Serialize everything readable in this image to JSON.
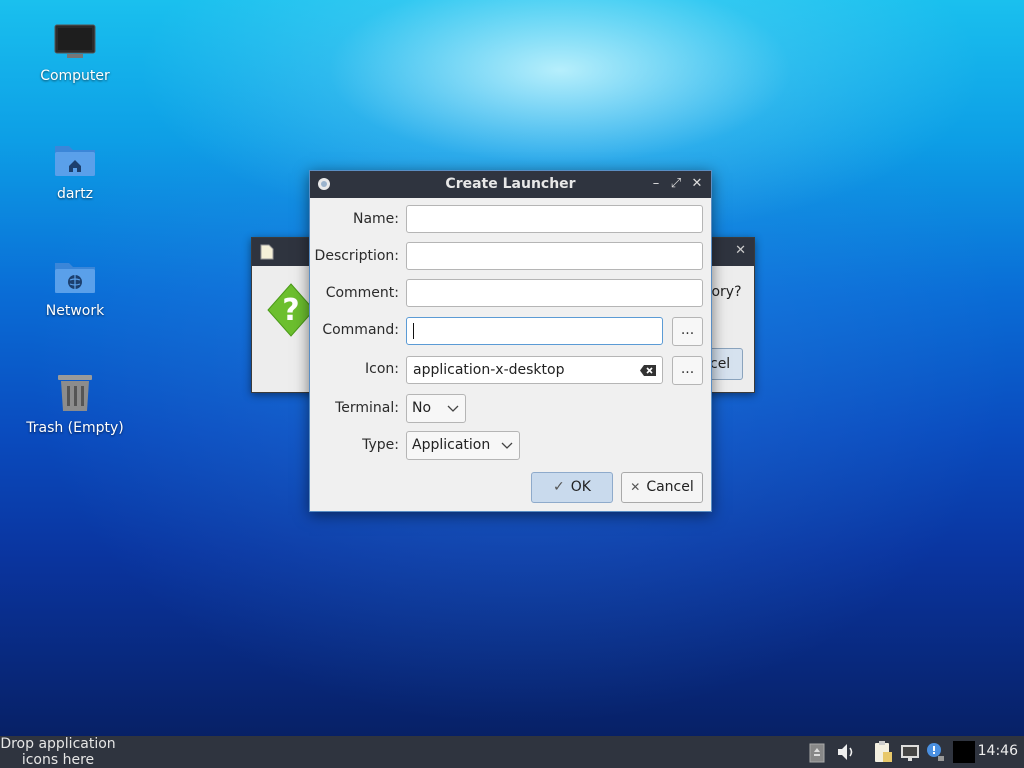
{
  "desktop": {
    "icons": [
      {
        "name": "computer",
        "label": "Computer"
      },
      {
        "name": "home-folder",
        "label": "dartz"
      },
      {
        "name": "network",
        "label": "Network"
      },
      {
        "name": "trash",
        "label": "Trash (Empty)"
      }
    ]
  },
  "taskbar": {
    "launcher_hint": "Drop application icons here",
    "clock": "14:46",
    "tray_icons": [
      "drive-icon",
      "volume-icon",
      "clipboard-icon",
      "network-icon",
      "notification-icon",
      "black-window-icon"
    ]
  },
  "background_dialog": {
    "partial_text": "tory?",
    "partial_button": "cel"
  },
  "dialog": {
    "title": "Create Launcher",
    "fields": {
      "name_label": "Name:",
      "name_value": "",
      "description_label": "Description:",
      "description_value": "",
      "comment_label": "Comment:",
      "comment_value": "",
      "command_label": "Command:",
      "command_value": "",
      "icon_label": "Icon:",
      "icon_value": "application-x-desktop",
      "terminal_label": "Terminal:",
      "terminal_value": "No",
      "type_label": "Type:",
      "type_value": "Application",
      "browse_label": "..."
    },
    "buttons": {
      "ok": "OK",
      "cancel": "Cancel"
    }
  },
  "colors": {
    "titlebar": "#2f343f",
    "dialog_bg": "#f0f0f0",
    "focus": "#5b9bd5",
    "ok_button": "#c9daed"
  }
}
